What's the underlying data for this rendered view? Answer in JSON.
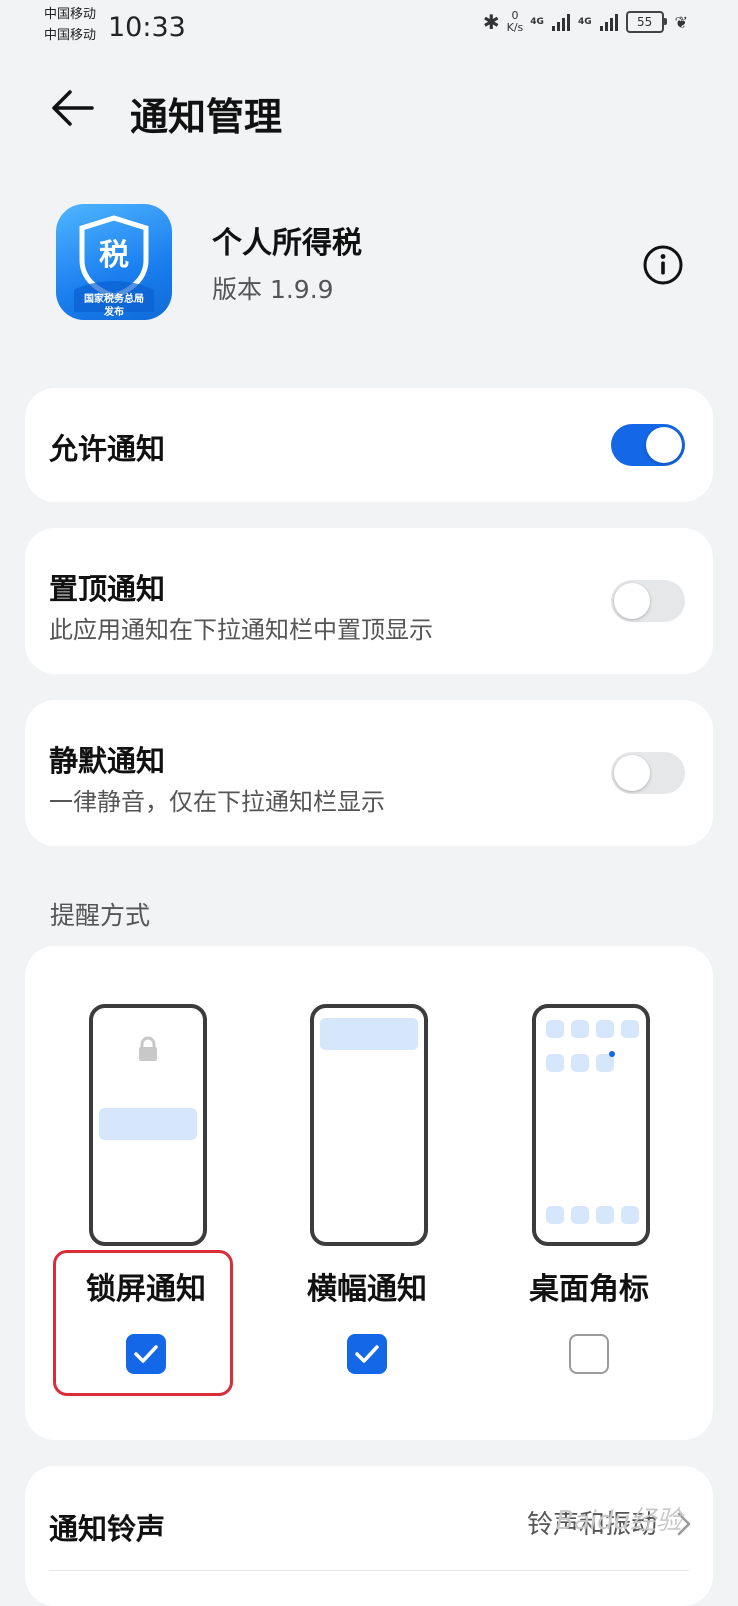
{
  "status_bar": {
    "carrier1": "中国移动",
    "carrier2": "中国移动",
    "time": "10:33",
    "net_speed_value": "0",
    "net_speed_unit": "K/s",
    "network1": "4G",
    "network2": "4G",
    "battery": "55"
  },
  "header": {
    "title": "通知管理"
  },
  "app": {
    "name": "个人所得税",
    "version": "版本 1.9.9",
    "icon_badge": "税",
    "icon_caption1": "国家税务总局",
    "icon_caption2": "发布"
  },
  "settings": {
    "allow": {
      "title": "允许通知",
      "enabled": true
    },
    "pinned": {
      "title": "置顶通知",
      "subtitle": "此应用通知在下拉通知栏中置顶显示",
      "enabled": false
    },
    "silent": {
      "title": "静默通知",
      "subtitle": "一律静音，仅在下拉通知栏显示",
      "enabled": false
    }
  },
  "reminder": {
    "section_label": "提醒方式",
    "options": [
      {
        "label": "锁屏通知",
        "checked": true
      },
      {
        "label": "横幅通知",
        "checked": true
      },
      {
        "label": "桌面角标",
        "checked": false
      }
    ]
  },
  "ringtone": {
    "title": "通知铃声",
    "value": "铃声和振动"
  },
  "watermark": "Baidu经验",
  "colors": {
    "accent": "#1467e6",
    "highlight": "#d92d3a",
    "background": "#f1f3f5"
  }
}
